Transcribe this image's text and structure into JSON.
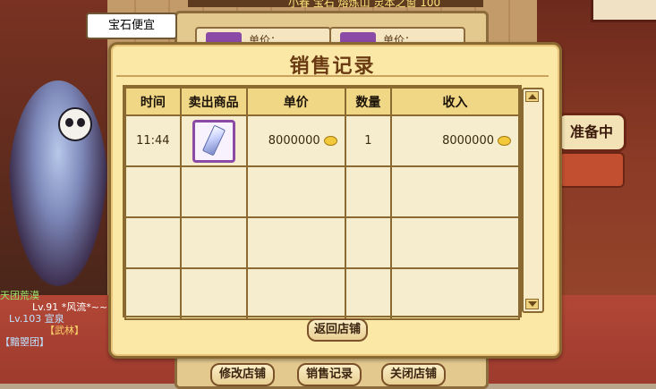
{
  "scene": {
    "tab_label": "宝石便宜",
    "top_banner": "小春 宝石 熔炼山 灵本之窗 100",
    "slot_label": "单价：",
    "sign_label": "准备中",
    "player_names": [
      "天团荒漠",
      "Lv.91 *风流*~~",
      "Lv.103 宣泉",
      "【武林】",
      "【黯曌团】"
    ]
  },
  "dialog": {
    "title": "销售记录",
    "columns": [
      "时间",
      "卖出商品",
      "单价",
      "数量",
      "收入"
    ],
    "rows": [
      {
        "time": "11:44",
        "item_icon": "crystal-gem-icon",
        "price": "8000000",
        "qty": "1",
        "income": "8000000"
      }
    ],
    "empty_rows": 3,
    "return_label": "返回店铺"
  },
  "bottom_buttons": {
    "modify": "修改店铺",
    "records": "销售记录",
    "close": "关闭店铺"
  },
  "colors": {
    "dialog_bg": "#fbe8a6",
    "header_bg": "#f0d786",
    "border": "#8b6a32",
    "coin": "#f3c93b"
  }
}
